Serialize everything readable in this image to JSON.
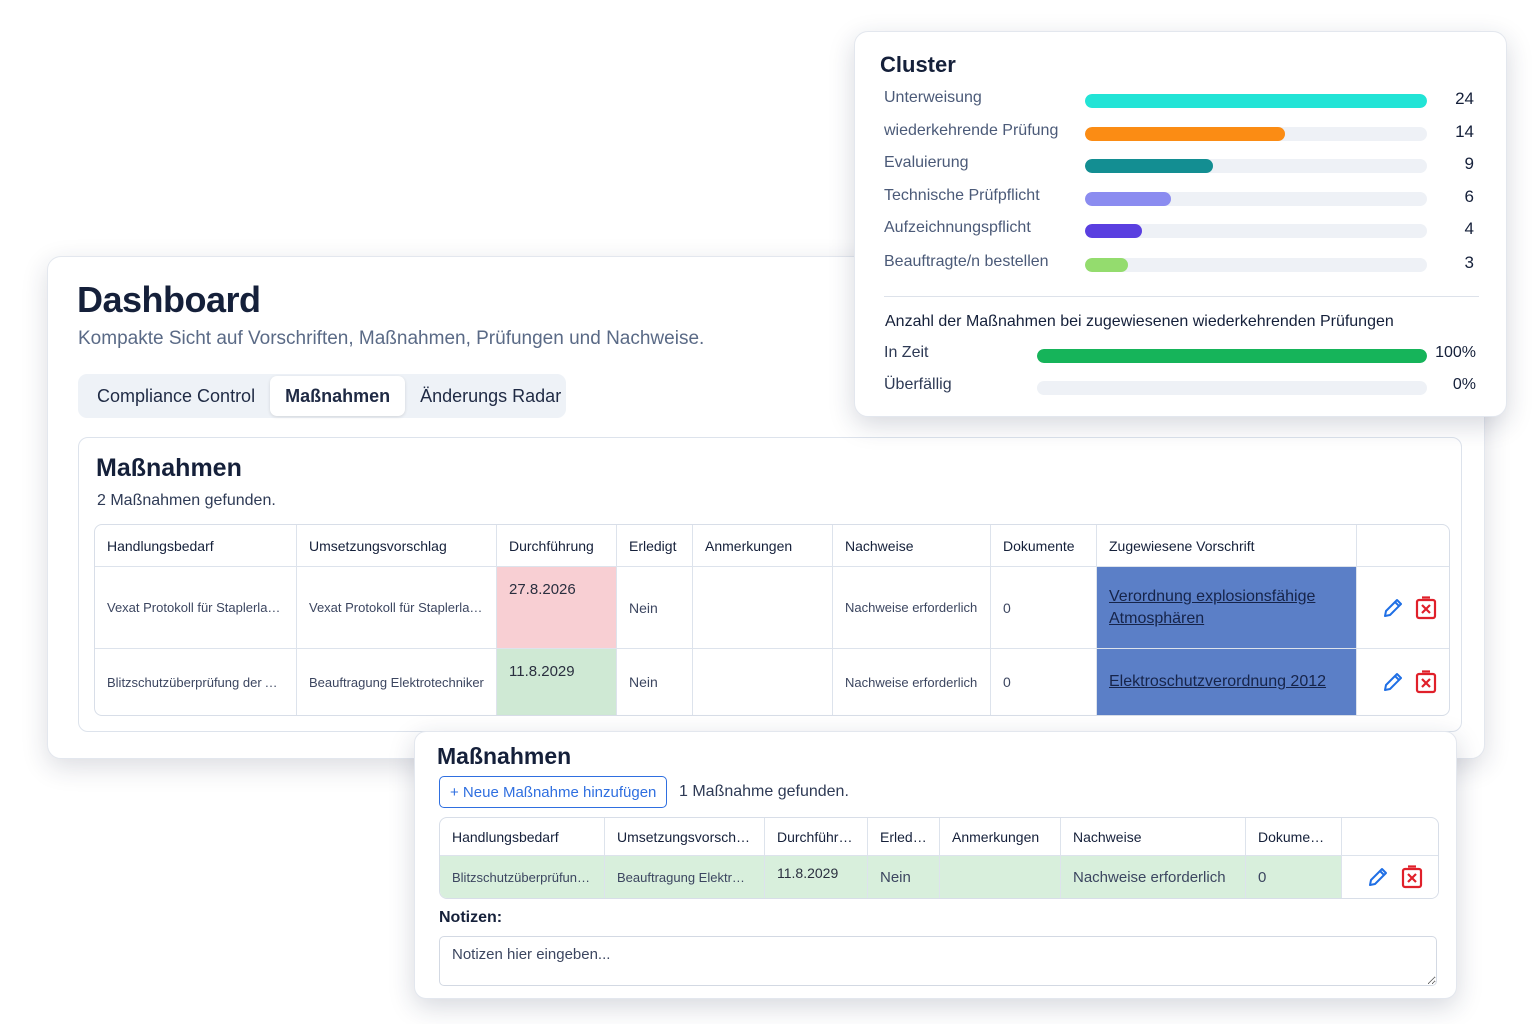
{
  "dashboard": {
    "title": "Dashboard",
    "subtitle": "Kompakte Sicht auf Vorschriften, Maßnahmen, Prüfungen und Nachweise.",
    "tabs": [
      {
        "label": "Compliance Control",
        "active": false
      },
      {
        "label": "Maßnahmen",
        "active": true
      },
      {
        "label": "Änderungs Radar",
        "active": false
      }
    ]
  },
  "massnahmen_panel": {
    "title": "Maßnahmen",
    "count_text": "2 Maßnahmen gefunden.",
    "headers": [
      "Handlungsbedarf",
      "Umsetzungsvorschlag",
      "Durchführung",
      "Erledigt",
      "Anmerkungen",
      "Nachweise",
      "Dokumente",
      "Zugewiesene Vorschrift"
    ],
    "rows": [
      {
        "handlungsbedarf": "Vexat Protokoll für Staplerladestation",
        "umsetzungsvorschlag": "Vexat Protokoll für Staplerladestation",
        "durchfuehrung": "27.8.2026",
        "durchfuehrung_status": "overdue",
        "erledigt": "Nein",
        "anmerkungen": "",
        "nachweise": "Nachweise erforderlich",
        "dokumente": "0",
        "vorschrift": "Verordnung explosionsfähige Atmosphären"
      },
      {
        "handlungsbedarf": "Blitzschutzüberprüfung der Anlage",
        "umsetzungsvorschlag": "Beauftragung Elektrotechniker",
        "durchfuehrung": "11.8.2029",
        "durchfuehrung_status": "on-time",
        "erledigt": "Nein",
        "anmerkungen": "",
        "nachweise": "Nachweise erforderlich",
        "dokumente": "0",
        "vorschrift": "Elektroschutzverordnung 2012"
      }
    ]
  },
  "cluster": {
    "title": "Cluster",
    "max": 24,
    "items": [
      {
        "label": "Unterweisung",
        "value": 24,
        "color": "#22e4d6"
      },
      {
        "label": "wiederkehrende Prüfung",
        "value": 14,
        "color": "#fb8c14"
      },
      {
        "label": "Evaluierung",
        "value": 9,
        "color": "#138e92"
      },
      {
        "label": "Technische Prüfpflicht",
        "value": 6,
        "color": "#8b8cf0"
      },
      {
        "label": "Aufzeichnungspflicht",
        "value": 4,
        "color": "#5a3fe0"
      },
      {
        "label": "Beauftragte/n bestellen",
        "value": 3,
        "color": "#94dc6e"
      }
    ],
    "pruefungen": {
      "title": "Anzahl der Maßnahmen bei zugewiesenen wiederkehrenden Prüfungen",
      "rows": [
        {
          "label": "In Zeit",
          "percent": 100,
          "value_text": "100%",
          "color": "#16b45a"
        },
        {
          "label": "Überfällig",
          "percent": 0,
          "value_text": "0%",
          "color": "#e04848"
        }
      ]
    }
  },
  "bottom": {
    "title": "Maßnahmen",
    "add_button": "+ Neue Maßnahme hinzufügen",
    "count_text": "1 Maßnahme gefunden.",
    "headers": [
      "Handlungsbedarf",
      "Umsetzungsvorschlag",
      "Durchführung",
      "Erledigt",
      "Anmerkungen",
      "Nachweise",
      "Dokumente"
    ],
    "row": {
      "handlungsbedarf": "Blitzschutzüberprüfung der Anlage",
      "umsetzungsvorschlag": "Beauftragung Elektrotechniker",
      "durchfuehrung": "11.8.2029",
      "erledigt": "Nein",
      "anmerkungen": "",
      "nachweise": "Nachweise erforderlich",
      "dokumente": "0"
    },
    "notes_label": "Notizen:",
    "notes_placeholder": "Notizen hier eingeben..."
  },
  "colors": {
    "edit_icon": "#1f6fe5",
    "delete_icon": "#e0202a",
    "vorschrift_bg": "#5b7fc7",
    "overdue_bg": "#f8cfd3",
    "ontime_bg": "#cfe9d4"
  },
  "icons": {
    "edit": "pencil-icon",
    "delete": "delete-x-icon"
  }
}
